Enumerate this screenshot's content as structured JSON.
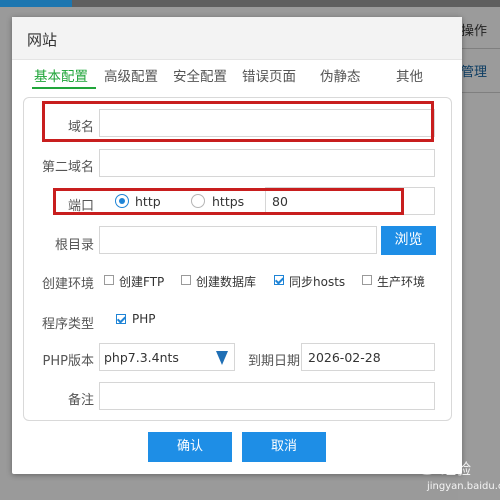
{
  "background": {
    "right_column": [
      "操作",
      "管理"
    ]
  },
  "dialog": {
    "title": "网站",
    "tabs": [
      {
        "label": "基本配置",
        "active": true
      },
      {
        "label": "高级配置",
        "active": false
      },
      {
        "label": "安全配置",
        "active": false
      },
      {
        "label": "错误页面",
        "active": false
      },
      {
        "label": "伪静态",
        "active": false
      },
      {
        "label": "其他",
        "active": false
      }
    ],
    "form": {
      "domain": {
        "label": "域名",
        "value": ""
      },
      "second_domain": {
        "label": "第二域名",
        "value": ""
      },
      "port": {
        "label": "端口",
        "protocols": [
          {
            "label": "http",
            "checked": true
          },
          {
            "label": "https",
            "checked": false
          }
        ],
        "value": "80"
      },
      "root_dir": {
        "label": "根目录",
        "value": "",
        "browse_label": "浏览"
      },
      "environment": {
        "label": "创建环境",
        "options": [
          {
            "label": "创建FTP",
            "checked": false
          },
          {
            "label": "创建数据库",
            "checked": false
          },
          {
            "label": "同步hosts",
            "checked": true
          },
          {
            "label": "生产环境",
            "checked": false
          }
        ]
      },
      "program_type": {
        "label": "程序类型",
        "options": [
          {
            "label": "PHP",
            "checked": true
          }
        ]
      },
      "php_version": {
        "label": "PHP版本",
        "value": "php7.3.4nts"
      },
      "expire_date": {
        "label": "到期日期",
        "value": "2026-02-28"
      },
      "note": {
        "label": "备注",
        "value": ""
      }
    },
    "buttons": {
      "confirm": "确认",
      "cancel": "取消"
    }
  },
  "colors": {
    "accent_green": "#20a53a",
    "button_blue": "#1e8ee6",
    "highlight_red": "#c81e1e"
  },
  "watermark": {
    "brand": "Bai",
    "suffix": "经验",
    "url": "jingyan.baidu.com"
  }
}
